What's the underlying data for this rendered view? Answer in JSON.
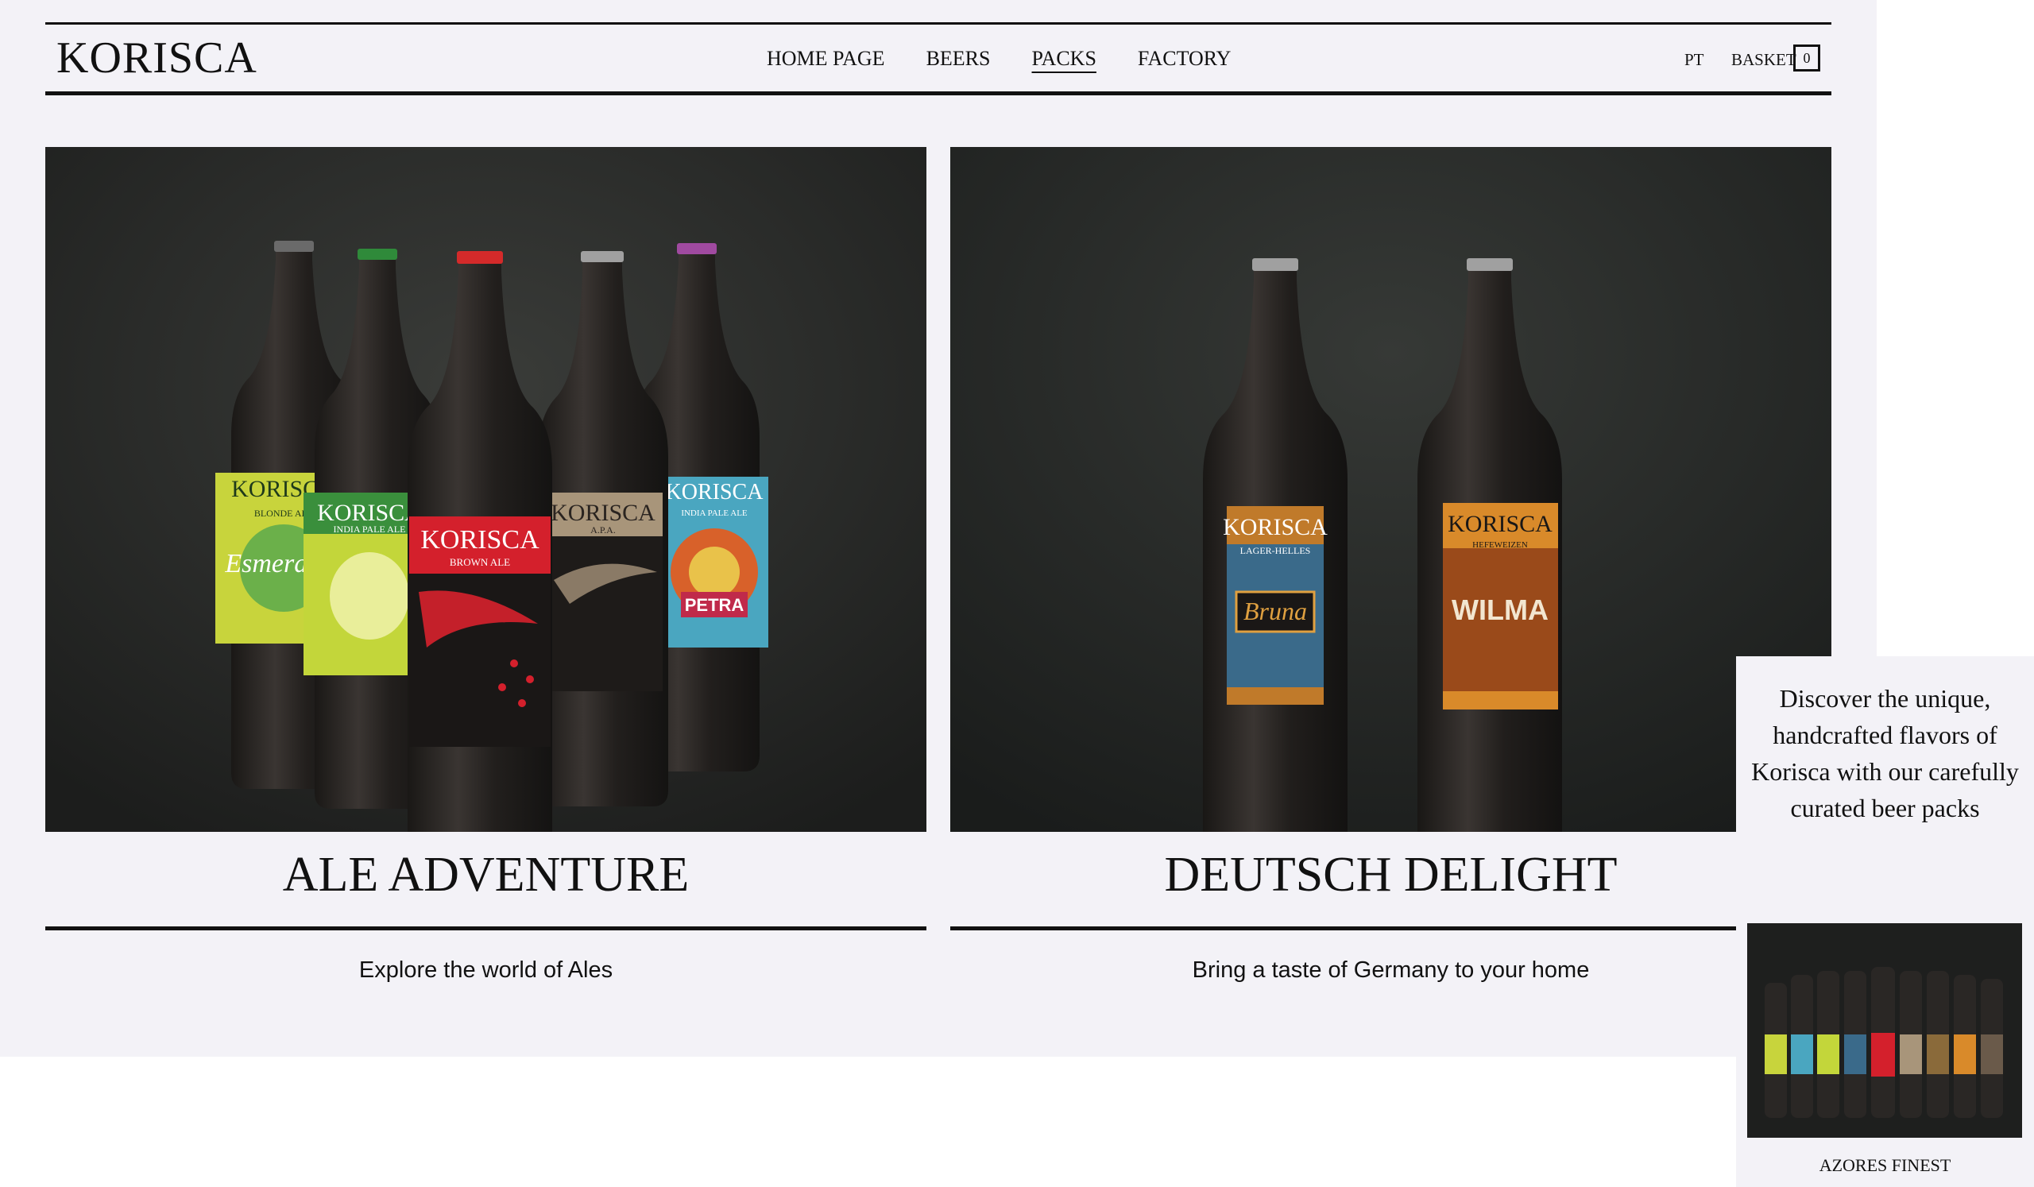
{
  "brand": {
    "logo": "KORISCA"
  },
  "nav": {
    "items": [
      {
        "label": "HOME PAGE",
        "active": false
      },
      {
        "label": "BEERS",
        "active": false
      },
      {
        "label": "PACKS",
        "active": true
      },
      {
        "label": "FACTORY",
        "active": false
      }
    ]
  },
  "header": {
    "language": "PT",
    "basket_label": "BASKET",
    "basket_count": "0"
  },
  "products": [
    {
      "title": "ALE ADVENTURE",
      "description": "Explore the world of Ales",
      "image": "five-korisca-ale-bottles",
      "bottle_labels": [
        "KORISCA",
        "KORISCA",
        "KORISCA",
        "KORISCA",
        "KORISCA"
      ],
      "bottle_styles": [
        "BLONDE ALE",
        "INDIA PALE ALE",
        "BROWN ALE",
        "A.P.A.",
        "INDIA PALE ALE"
      ],
      "bottle_names": [
        "Esmeralda",
        "",
        "",
        "",
        "PETRA"
      ]
    },
    {
      "title": "DEUTSCH DELIGHT",
      "description": "Bring a taste of Germany to your home",
      "image": "two-korisca-german-bottles",
      "bottle_labels": [
        "KORISCA",
        "KORISCA"
      ],
      "bottle_styles": [
        "LAGER-HELLES",
        "HEFEWEIZEN"
      ],
      "bottle_names": [
        "Bruna",
        "WILMA"
      ]
    }
  ],
  "popup": {
    "blurb_lines": [
      "Discover the unique,",
      "handcrafted flavors of",
      "Korisca with our carefully",
      "curated beer packs"
    ],
    "caption": "AZORES FINEST",
    "image": "lineup-of-korisca-bottles"
  },
  "colors": {
    "page_bg": "#f3f2f7",
    "photo_bg": "#2b2d2b",
    "label_yellow": "#c8d43c",
    "label_green": "#3a8f3c",
    "label_red": "#d4202c",
    "label_tan": "#a8957a",
    "label_blue": "#4aa6c0",
    "label_orange": "#d98a2a"
  }
}
